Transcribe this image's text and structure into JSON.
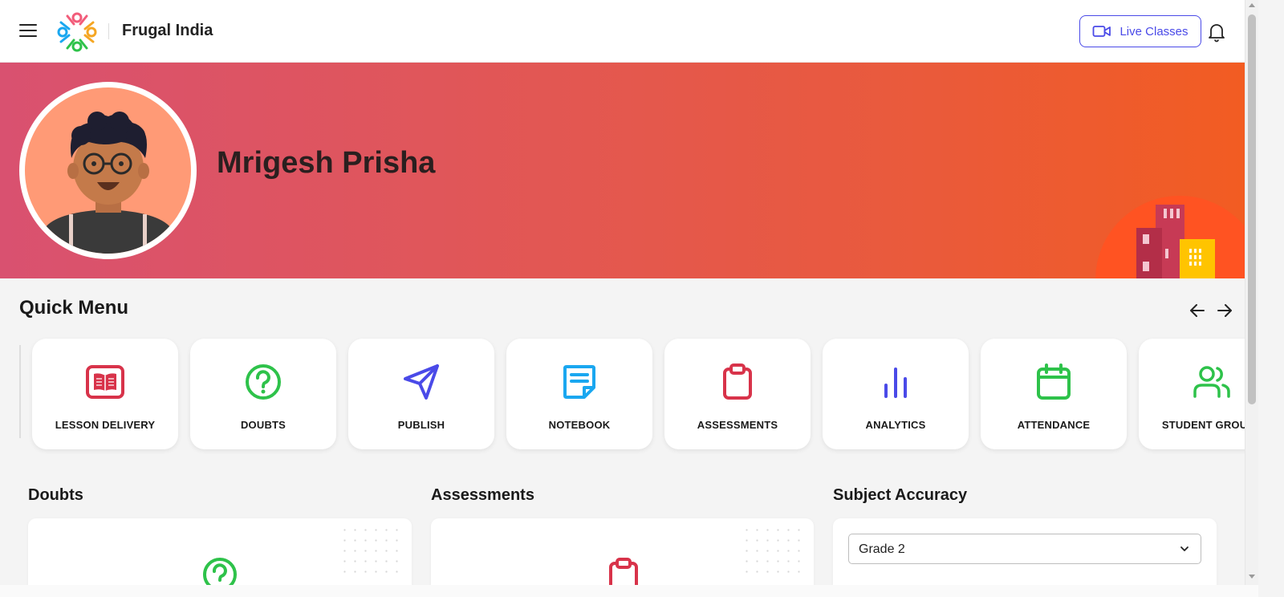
{
  "header": {
    "brand": "Frugal India",
    "live_classes_label": "Live Classes"
  },
  "profile": {
    "name": "Mrigesh Prisha"
  },
  "quick_menu": {
    "title": "Quick Menu",
    "items": [
      {
        "label": "LESSON DELIVERY",
        "icon": "book-icon",
        "color": "#d8334a"
      },
      {
        "label": "DOUBTS",
        "icon": "question-icon",
        "color": "#2ec24a"
      },
      {
        "label": "PUBLISH",
        "icon": "send-icon",
        "color": "#4a4ae8"
      },
      {
        "label": "NOTEBOOK",
        "icon": "notebook-icon",
        "color": "#1aa7f0"
      },
      {
        "label": "ASSESSMENTS",
        "icon": "clipboard-icon",
        "color": "#d8334a"
      },
      {
        "label": "ANALYTICS",
        "icon": "bar-chart-icon",
        "color": "#4a4ae8"
      },
      {
        "label": "ATTENDANCE",
        "icon": "calendar-icon",
        "color": "#2ec24a"
      },
      {
        "label": "STUDENT GROUPS",
        "icon": "users-icon",
        "color": "#2ec24a"
      }
    ]
  },
  "sections": {
    "doubts_title": "Doubts",
    "assessments_title": "Assessments",
    "subject_accuracy_title": "Subject Accuracy",
    "grade_select_value": "Grade 2"
  },
  "colors": {
    "accent": "#4a4ae8",
    "banner_start": "#d95170",
    "banner_end": "#f25c22"
  }
}
